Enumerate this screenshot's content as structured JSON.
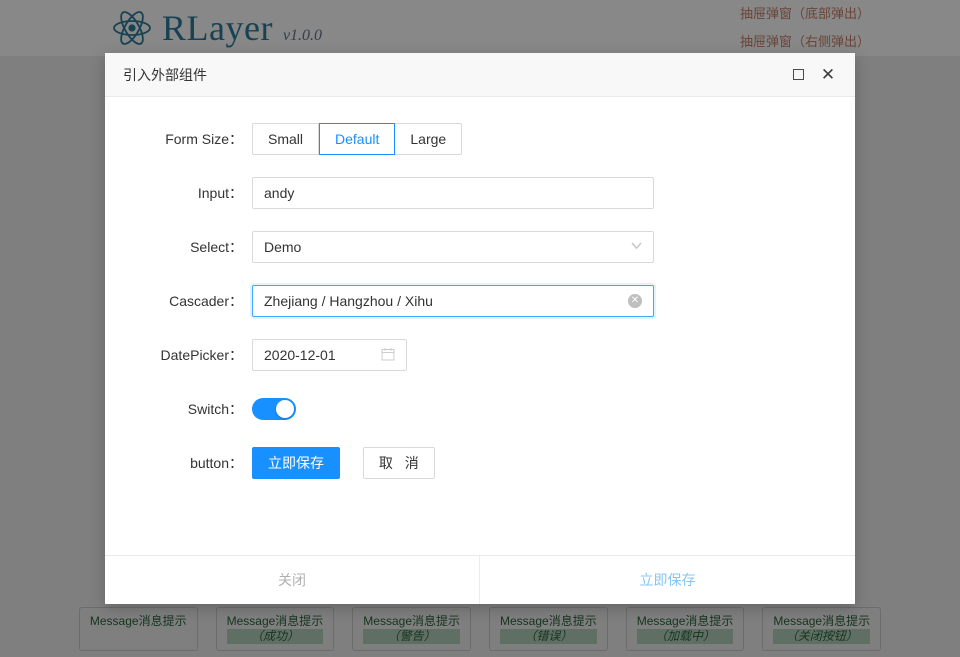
{
  "background": {
    "logo": {
      "name": "RLayer",
      "version": "v1.0.0",
      "icon": "react-atom-icon"
    },
    "right_links": [
      {
        "text": "抽屉弹窗（底部弹出）"
      },
      {
        "text": "抽屉弹窗（右侧弹出）"
      }
    ],
    "message_buttons": [
      {
        "main": "Message消息提示",
        "sub": ""
      },
      {
        "main": "Message消息提示",
        "sub": "（成功）"
      },
      {
        "main": "Message消息提示",
        "sub": "（警告）"
      },
      {
        "main": "Message消息提示",
        "sub": "（错误）"
      },
      {
        "main": "Message消息提示",
        "sub": "（加载中）"
      },
      {
        "main": "Message消息提示",
        "sub": "（关闭按钮）"
      }
    ]
  },
  "modal": {
    "title": "引入外部组件",
    "header_icons": {
      "maximize": "maximize-icon",
      "close": "close-icon"
    },
    "form": {
      "form_size": {
        "label": "Form Size：",
        "options": [
          "Small",
          "Default",
          "Large"
        ],
        "selected": "Default"
      },
      "input": {
        "label": "Input：",
        "value": "andy",
        "placeholder": ""
      },
      "select": {
        "label": "Select：",
        "value": "Demo",
        "icon": "chevron-down-icon"
      },
      "cascader": {
        "label": "Cascader：",
        "value": "Zhejiang / Hangzhou / Xihu",
        "icon": "clear-circle-icon",
        "focused": true
      },
      "datepicker": {
        "label": "DatePicker：",
        "value": "2020-12-01",
        "icon": "calendar-icon"
      },
      "switch": {
        "label": "Switch：",
        "checked": true
      },
      "buttons": {
        "label": "button：",
        "primary": "立即保存",
        "secondary": "取 消"
      }
    },
    "footer": {
      "cancel": "关闭",
      "confirm": "立即保存"
    }
  },
  "colors": {
    "primary": "#1890ff",
    "focus_border": "#40a9ff",
    "border": "#d9d9d9",
    "footer_confirm": "#84c5f5",
    "footer_cancel": "#b0b0b0",
    "logo": "#2e7d9a"
  }
}
